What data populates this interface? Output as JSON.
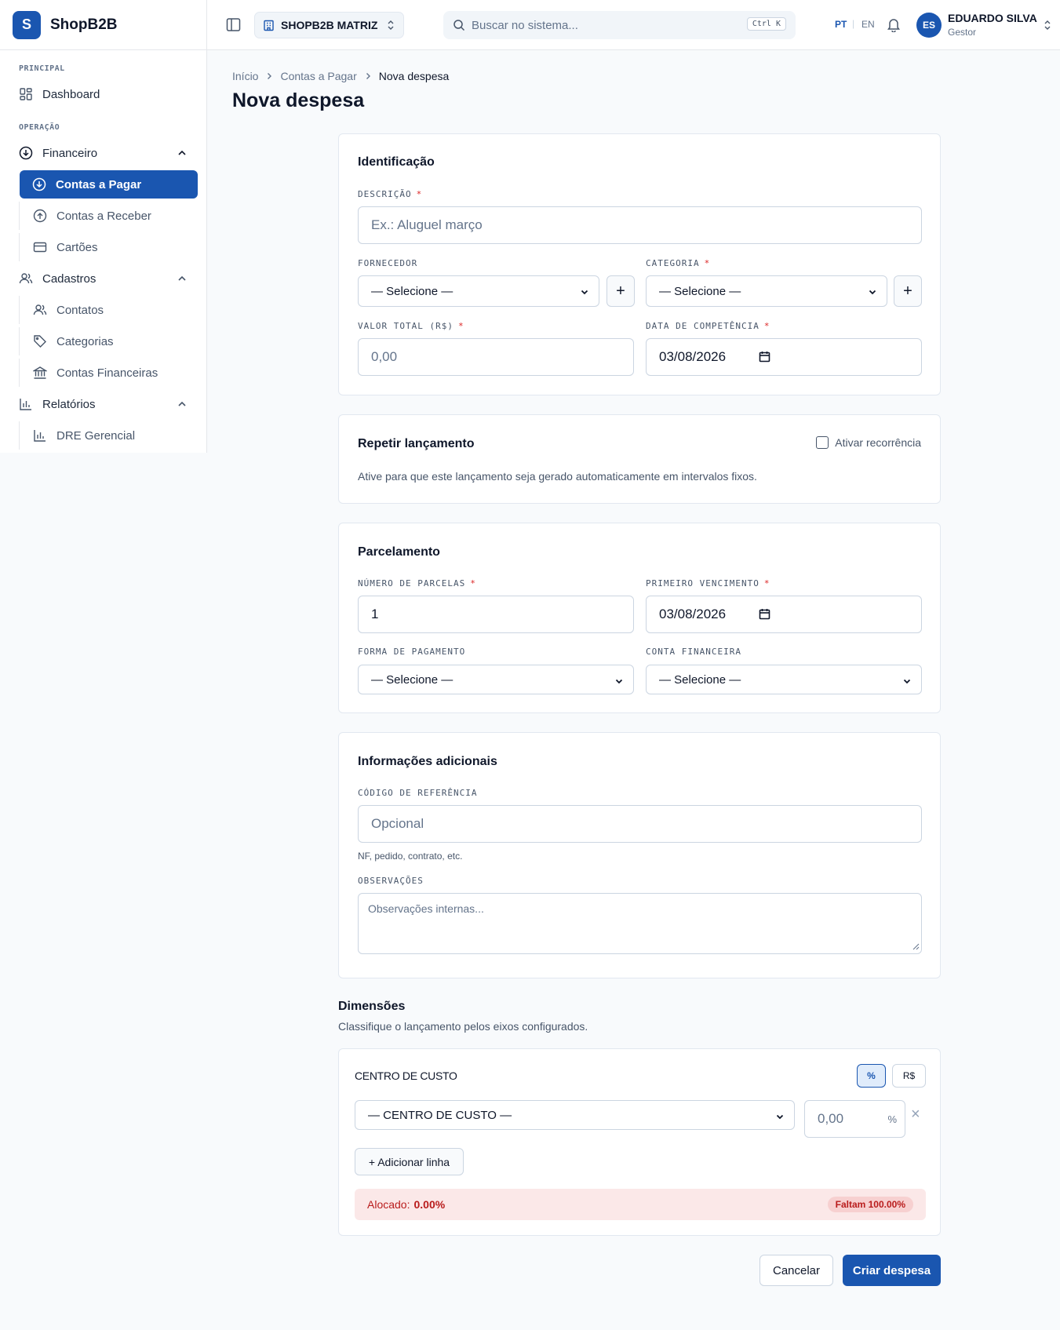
{
  "brand": {
    "logo_letter": "S",
    "name": "ShopB2B"
  },
  "sidebar": {
    "sections": {
      "principal": "PRINCIPAL",
      "operacao": "OPERAÇÃO"
    },
    "dashboard": "Dashboard",
    "financeiro": {
      "label": "Financeiro",
      "items": [
        "Contas a Pagar",
        "Contas a Receber",
        "Cartões"
      ]
    },
    "cadastros": {
      "label": "Cadastros",
      "items": [
        "Contatos",
        "Categorias",
        "Contas Financeiras"
      ]
    },
    "relatorios": {
      "label": "Relatórios",
      "items": [
        "DRE Gerencial"
      ]
    }
  },
  "topbar": {
    "company": "SHOPB2B MATRIZ",
    "search_placeholder": "Buscar no sistema...",
    "search_shortcut": "Ctrl K",
    "lang_active": "PT",
    "lang_other": "EN",
    "user_initials": "ES",
    "user_name": "EDUARDO SILVA",
    "user_role": "Gestor"
  },
  "breadcrumb": [
    "Início",
    "Contas a Pagar",
    "Nova despesa"
  ],
  "page_title": "Nova despesa",
  "identificacao": {
    "title": "Identificação",
    "descricao_label": "DESCRIÇÃO",
    "descricao_placeholder": "Ex.: Aluguel março",
    "fornecedor_label": "FORNECEDOR",
    "fornecedor_value": "— Selecione —",
    "categoria_label": "CATEGORIA",
    "categoria_value": "— Selecione —",
    "valor_label": "VALOR TOTAL (R$)",
    "valor_placeholder": "0,00",
    "competencia_label": "DATA DE COMPETÊNCIA",
    "competencia_value": "03/08/2026",
    "plus": "+"
  },
  "repetir": {
    "title": "Repetir lançamento",
    "checkbox_label": "Ativar recorrência",
    "description": "Ative para que este lançamento seja gerado automaticamente em intervalos fixos."
  },
  "parcelamento": {
    "title": "Parcelamento",
    "parcelas_label": "NÚMERO DE PARCELAS",
    "parcelas_value": "1",
    "vencimento_label": "PRIMEIRO VENCIMENTO",
    "vencimento_value": "03/08/2026",
    "forma_label": "FORMA DE PAGAMENTO",
    "forma_value": "— Selecione —",
    "conta_label": "CONTA FINANCEIRA",
    "conta_value": "— Selecione —"
  },
  "adicionais": {
    "title": "Informações adicionais",
    "codigo_label": "CÓDIGO DE REFERÊNCIA",
    "codigo_placeholder": "Opcional",
    "codigo_hint": "NF, pedido, contrato, etc.",
    "obs_label": "OBSERVAÇÕES",
    "obs_placeholder": "Observações internas..."
  },
  "dimensoes": {
    "title": "Dimensões",
    "subtitle": "Classifique o lançamento pelos eixos configurados.",
    "centro_label": "CENTRO DE CUSTO",
    "mode_percent": "%",
    "mode_money": "R$",
    "select_value": "— CENTRO DE CUSTO —",
    "amount_placeholder": "0,00",
    "amount_unit": "%",
    "remove": "×",
    "add_line": "+ Adicionar linha",
    "alocado_label": "Alocado:",
    "alocado_value": "0.00%",
    "faltam": "Faltam 100.00%"
  },
  "actions": {
    "cancel": "Cancelar",
    "submit": "Criar despesa"
  },
  "colors": {
    "primary": "#1a56b0",
    "danger": "#dc2626",
    "danger_bg": "#fbe8e8"
  }
}
